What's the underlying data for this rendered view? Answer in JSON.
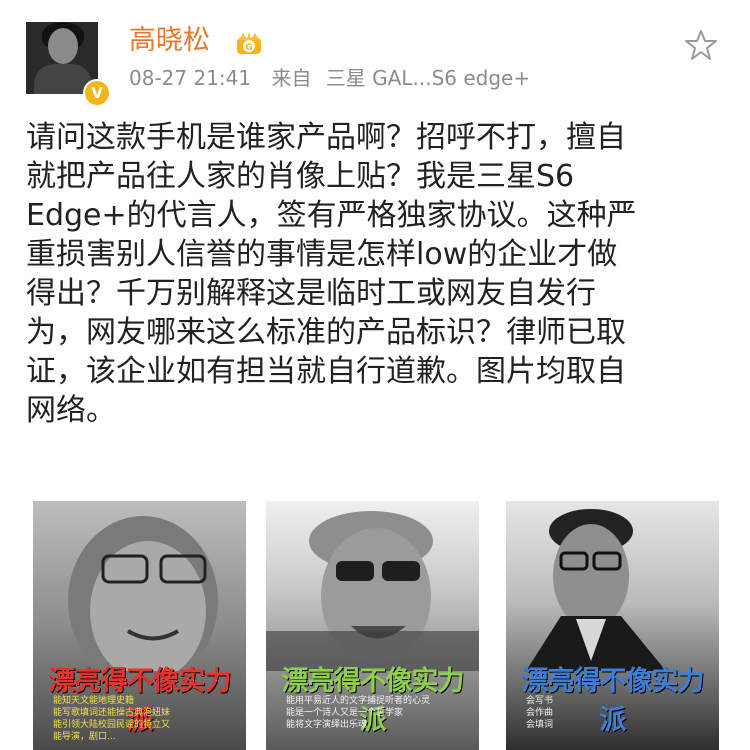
{
  "post": {
    "username": "高晓松",
    "verified_badge": "V",
    "time": "08-27 21:41",
    "source_prefix": "来自",
    "source": "三星 GAL...S6 edge+",
    "content_lines": [
      "请问这款手机是谁家产品啊？招呼不打，擅自",
      "就把产品往人家的肖像上贴？我是三星S6",
      "Edge+的代言人，签有严格独家协议。这种严",
      "重损害别人信誉的事情是怎样low的企业才做",
      "得出？千万别解释这是临时工或网友自发行",
      "为，网友哪来这么标准的产品标识？律师已取",
      "证，该企业如有担当就自行道歉。图片均取自",
      "网络。"
    ]
  },
  "icons": {
    "avatar": "avatar",
    "crown": "crown-icon",
    "star": "star-icon"
  },
  "colors": {
    "username": "#e8782b",
    "meta": "#8c8c8c",
    "badge": "#f4b51b",
    "poster1_title": "#e8322c",
    "poster2_title": "#8fd04a",
    "poster3_title": "#3d7fd8"
  },
  "images": [
    {
      "title": "漂亮得不像实力派",
      "caption": [
        "能知天文能地理史籍",
        "能写歌填词还能操古典泡妞妹",
        "能引领大陆校园民谣的特立又",
        "能导演，剧口..."
      ]
    },
    {
      "title": "漂亮得不像实力派",
      "caption": [
        "能用平易近人的文字捕捉听者的心灵",
        "能是一个诗人又是一个哲学家",
        "能将文字演绎出乐魂"
      ]
    },
    {
      "title": "漂亮得不像实力派",
      "caption": [
        "会写书",
        "会作曲",
        "会填词"
      ]
    }
  ]
}
